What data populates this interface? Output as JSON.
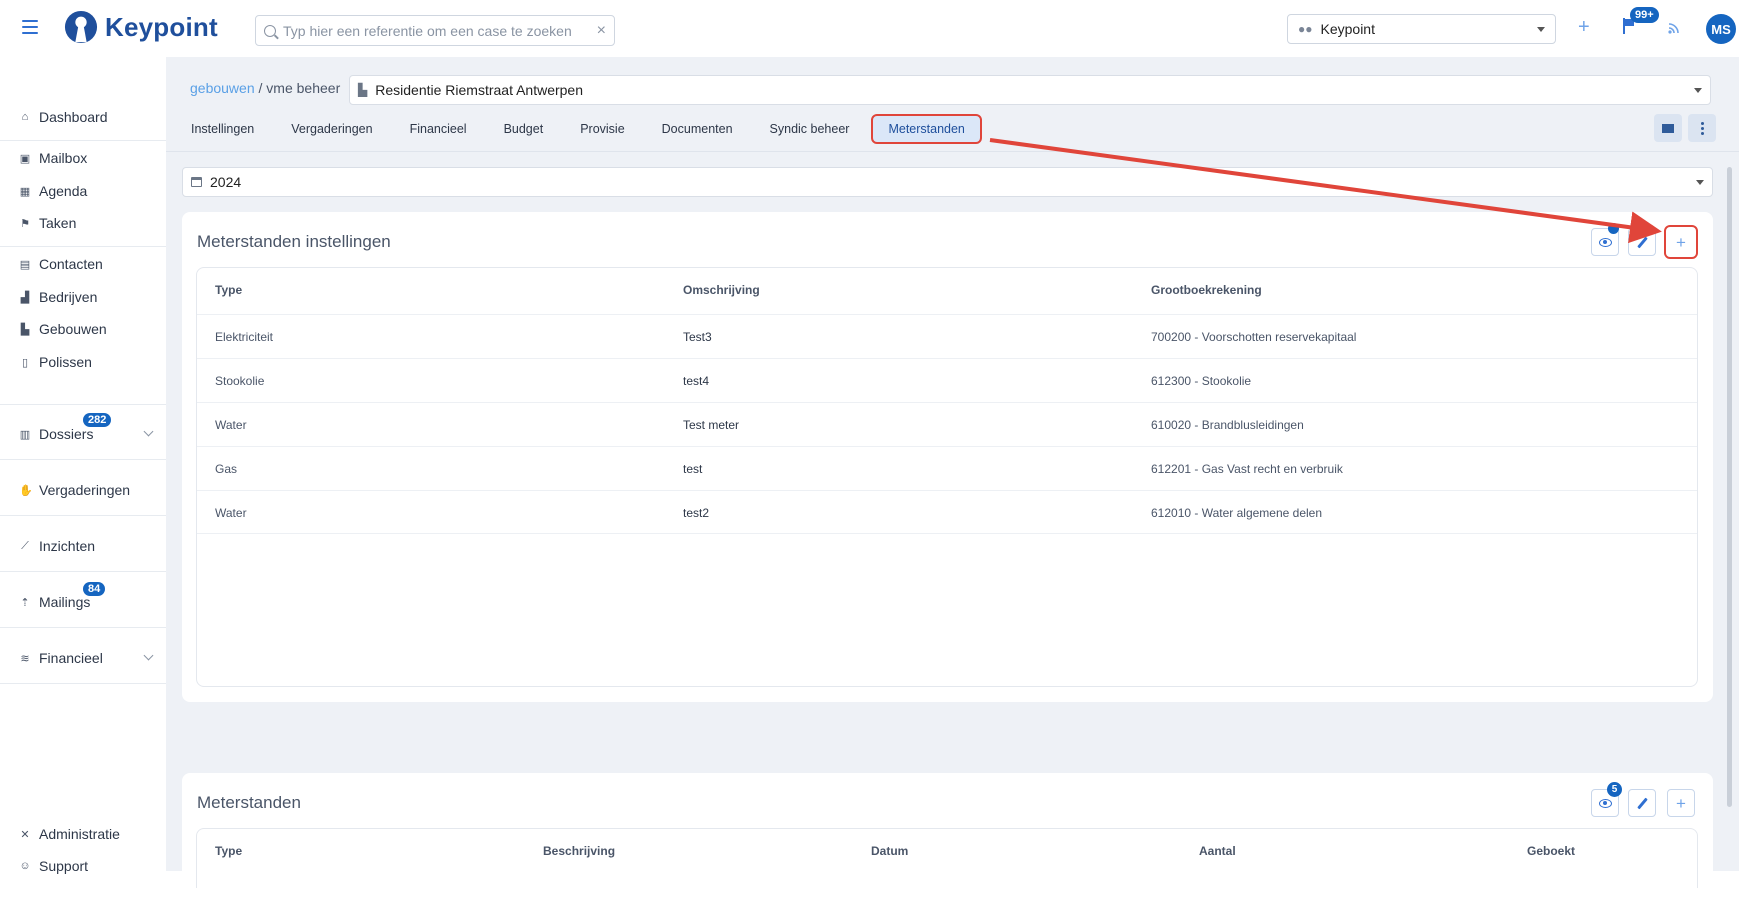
{
  "app": {
    "logo_text": "Keypoint",
    "search_placeholder": "Typ hier een referentie om een case te zoeken",
    "tenant": "Keypoint",
    "notifications_badge": "99+",
    "avatar_initials": "MS"
  },
  "sidebar": {
    "items": [
      {
        "label": "Dashboard",
        "icon": "home-icon"
      },
      {
        "label": "Mailbox",
        "icon": "inbox-icon"
      },
      {
        "label": "Agenda",
        "icon": "calendar-icon"
      },
      {
        "label": "Taken",
        "icon": "flag-icon"
      },
      {
        "label": "Contacten",
        "icon": "contacts-icon"
      },
      {
        "label": "Bedrijven",
        "icon": "industry-icon"
      },
      {
        "label": "Gebouwen",
        "icon": "building-icon"
      },
      {
        "label": "Polissen",
        "icon": "document-icon"
      },
      {
        "label": "Dossiers",
        "icon": "archive-icon",
        "badge": "282"
      },
      {
        "label": "Vergaderingen",
        "icon": "handshake-icon"
      },
      {
        "label": "Inzichten",
        "icon": "chart-line-icon"
      },
      {
        "label": "Mailings",
        "icon": "upload-icon",
        "badge": "84"
      },
      {
        "label": "Financieel",
        "icon": "coins-icon"
      },
      {
        "label": "Administratie",
        "icon": "tools-icon"
      },
      {
        "label": "Support",
        "icon": "user-support-icon"
      }
    ]
  },
  "header": {
    "breadcrumb_link": "gebouwen",
    "breadcrumb_rest": " / vme beheer",
    "building": "Residentie Riemstraat Antwerpen",
    "tabs": [
      "Instellingen",
      "Vergaderingen",
      "Financieel",
      "Budget",
      "Provisie",
      "Documenten",
      "Syndic beheer",
      "Meterstanden"
    ],
    "active_tab": "Meterstanden"
  },
  "year": "2024",
  "settings_card": {
    "title": "Meterstanden instellingen",
    "columns": [
      "Type",
      "Omschrijving",
      "Grootboekrekening"
    ],
    "rows": [
      [
        "Elektriciteit",
        "Test3",
        "700200 - Voorschotten reservekapitaal"
      ],
      [
        "Stookolie",
        "test4",
        "612300 - Stookolie"
      ],
      [
        "Water",
        "Test meter",
        "610020 - Brandblusleidingen"
      ],
      [
        "Gas",
        "test",
        "612201 - Gas Vast recht en verbruik"
      ],
      [
        "Water",
        "test2",
        "612010 - Water algemene delen"
      ]
    ]
  },
  "readings_card": {
    "title": "Meterstanden",
    "view_badge": "5",
    "columns": [
      "Type",
      "Beschrijving",
      "Datum",
      "Aantal",
      "Geboekt"
    ]
  },
  "colors": {
    "accent": "#1565c0",
    "link": "#5aa0e6",
    "highlight": "#e0453a",
    "background": "#eef1f6"
  }
}
